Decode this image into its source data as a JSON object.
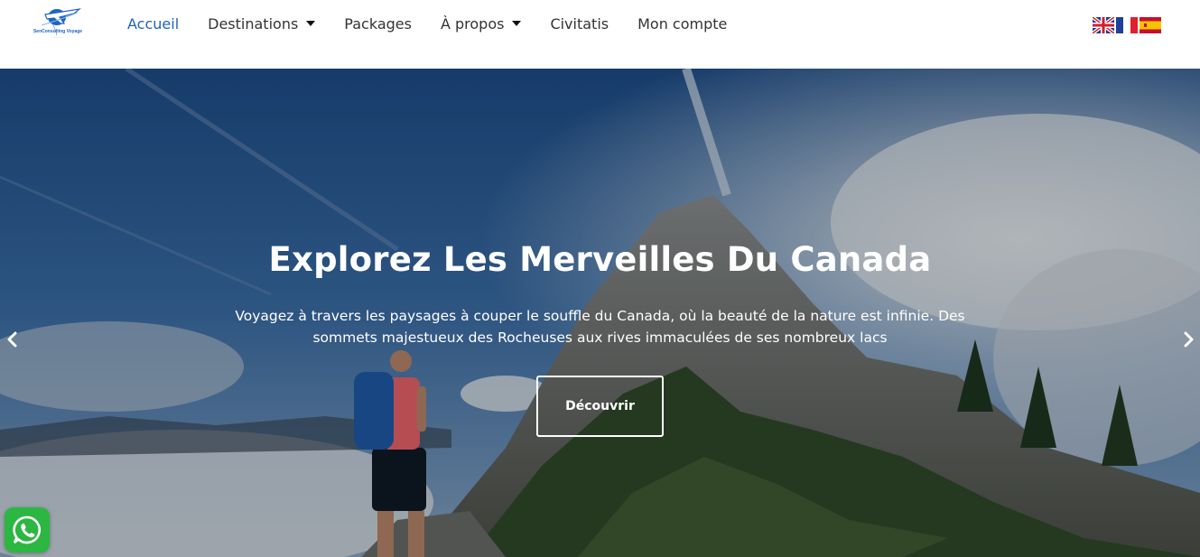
{
  "brand": {
    "logo_text": "SenConsulting Voyage",
    "primary_color": "#1f64b8"
  },
  "nav": {
    "items": [
      {
        "label": "Accueil",
        "active": true,
        "dropdown": false
      },
      {
        "label": "Destinations",
        "active": false,
        "dropdown": true
      },
      {
        "label": "Packages",
        "active": false,
        "dropdown": false
      },
      {
        "label": "À propos",
        "active": false,
        "dropdown": true
      },
      {
        "label": "Civitatis",
        "active": false,
        "dropdown": false
      },
      {
        "label": "Mon compte",
        "active": false,
        "dropdown": false
      }
    ]
  },
  "languages": [
    {
      "icon": "uk-flag-icon"
    },
    {
      "icon": "france-flag-icon"
    },
    {
      "icon": "spain-flag-icon"
    }
  ],
  "hero": {
    "title": "Explorez Les Merveilles Du Canada",
    "text_line1": "Voyagez à travers les paysages à couper le souffle du Canada, où la beauté de la nature est infinie. Des",
    "text_line2": "sommets majestueux des Rocheuses aux rives immaculées de ses nombreux lacs",
    "button_label": "Découvrir"
  },
  "icons": {
    "prev": "chevron-left-icon",
    "next": "chevron-right-icon",
    "chat": "whatsapp-icon"
  }
}
